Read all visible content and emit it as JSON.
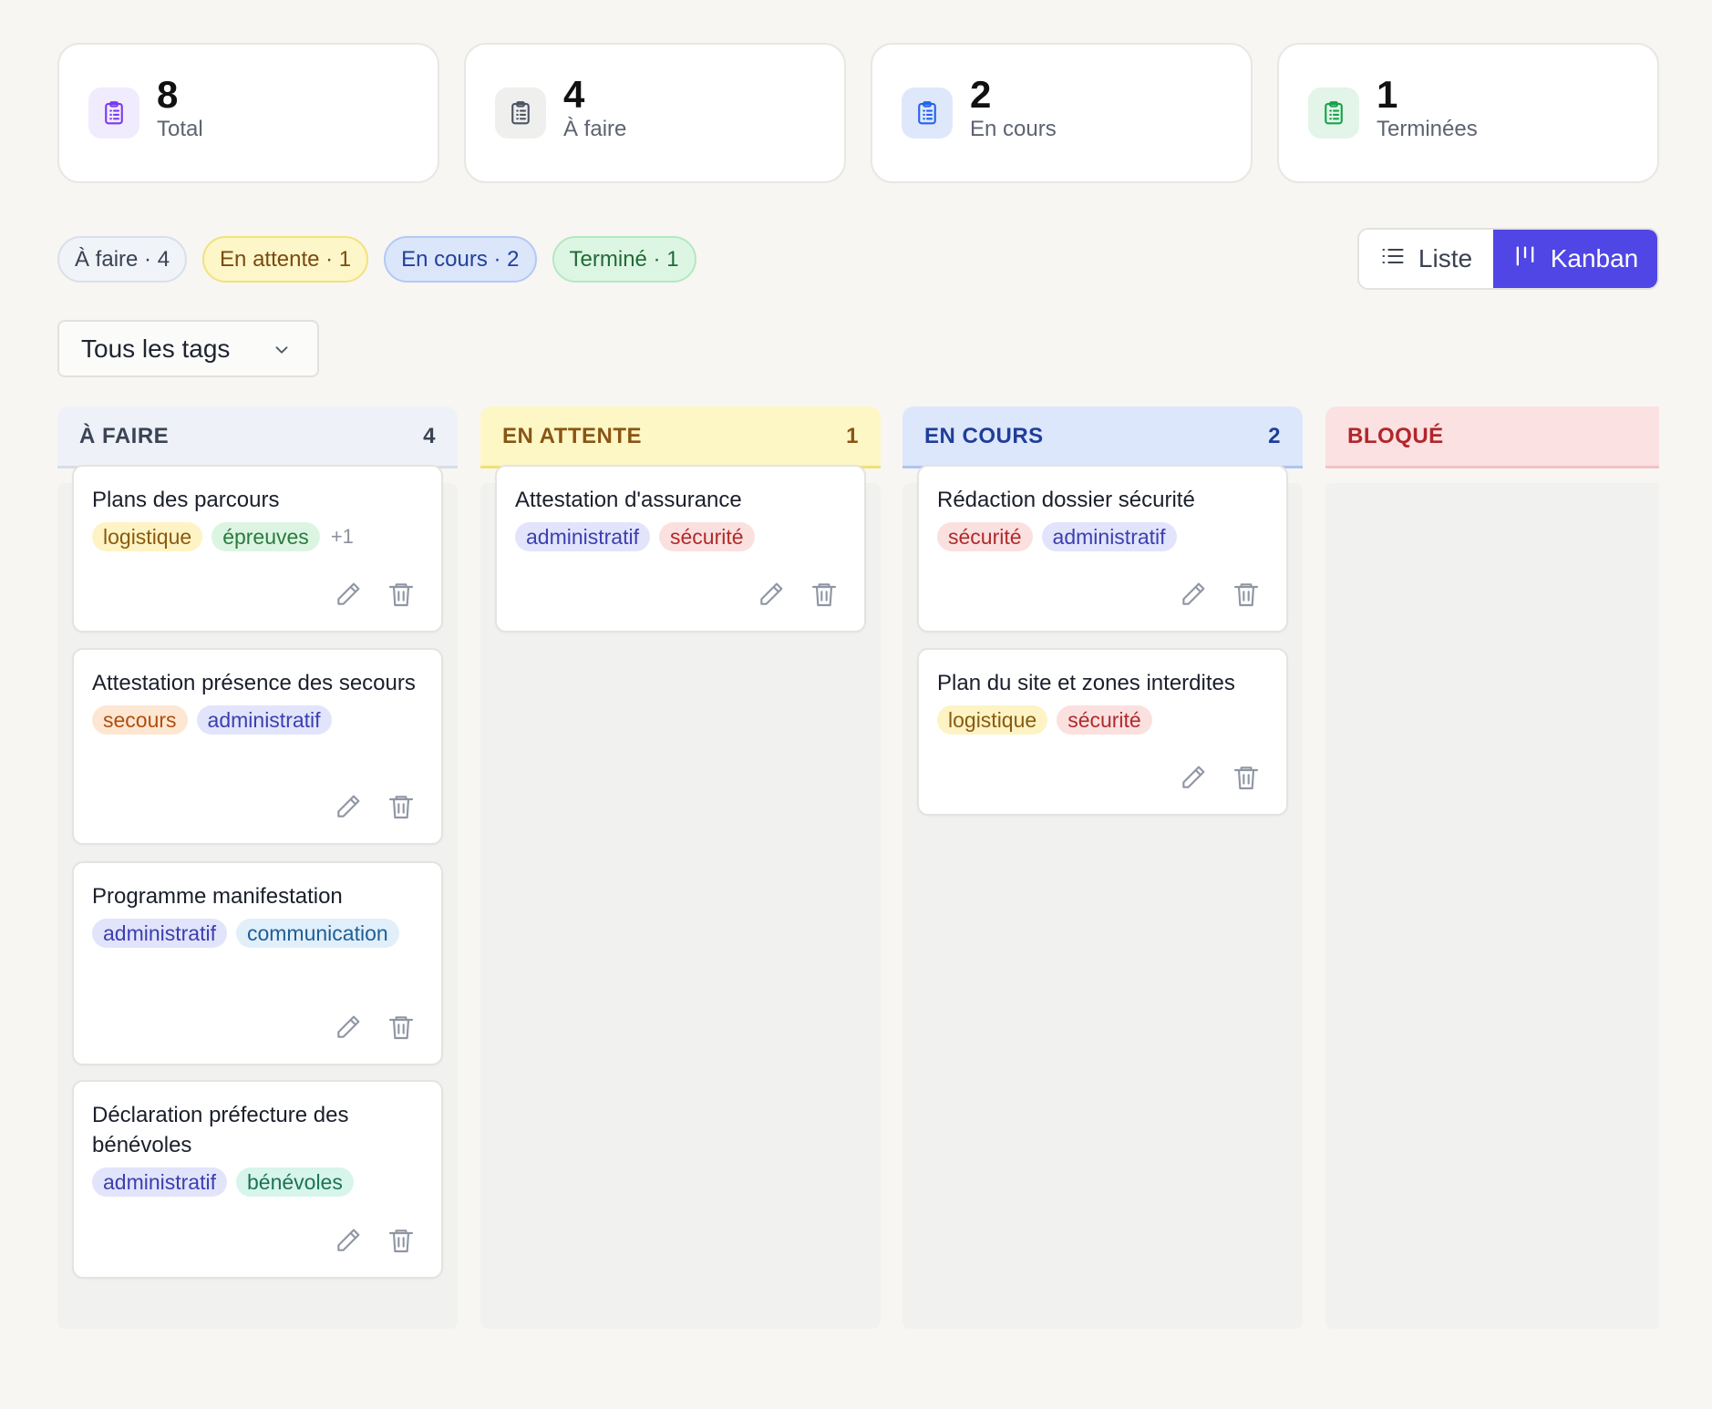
{
  "stats": [
    {
      "value": "8",
      "label": "Total",
      "icon": "clipboard-list-icon",
      "bg": "#f1ecfd",
      "color": "#7c3aed"
    },
    {
      "value": "4",
      "label": "À faire",
      "icon": "clipboard-list-icon",
      "bg": "#efefee",
      "color": "#4b5563"
    },
    {
      "value": "2",
      "label": "En cours",
      "icon": "clipboard-list-icon",
      "bg": "#dfe8fb",
      "color": "#2563eb"
    },
    {
      "value": "1",
      "label": "Terminées",
      "icon": "clipboard-list-icon",
      "bg": "#e3f4e8",
      "color": "#16a34a"
    }
  ],
  "status_chips": [
    {
      "label": "À faire · 4",
      "variant": "todo"
    },
    {
      "label": "En attente · 1",
      "variant": "wait"
    },
    {
      "label": "En cours · 2",
      "variant": "doing"
    },
    {
      "label": "Terminé · 1",
      "variant": "done"
    }
  ],
  "view_toggle": {
    "list_label": "Liste",
    "kanban_label": "Kanban",
    "active": "kanban"
  },
  "tag_filter": {
    "value": "Tous les tags"
  },
  "tag_colors": {
    "logistique": {
      "bg": "#fdf3c4",
      "fg": "#8a5a10"
    },
    "épreuves": {
      "bg": "#dcf5e2",
      "fg": "#2a7a3f"
    },
    "secours": {
      "bg": "#fde7d2",
      "fg": "#b04e0f"
    },
    "administratif": {
      "bg": "#e2e4fb",
      "fg": "#3b3fb0"
    },
    "communication": {
      "bg": "#e1effb",
      "fg": "#1f5e95"
    },
    "bénévoles": {
      "bg": "#d7f5ea",
      "fg": "#1c7356"
    },
    "sécurité": {
      "bg": "#fbe0e0",
      "fg": "#b12a2a"
    }
  },
  "columns": [
    {
      "key": "todo",
      "title": "À FAIRE",
      "count": "4",
      "cards": [
        {
          "title": "Plans des parcours",
          "tags": [
            "logistique",
            "épreuves"
          ],
          "more": "+1"
        },
        {
          "title": "Attestation présence des secours",
          "tags": [
            "secours",
            "administratif"
          ],
          "more": ""
        },
        {
          "title": "Programme manifestation",
          "tags": [
            "administratif",
            "communication"
          ],
          "more": ""
        },
        {
          "title": "Déclaration préfecture des bénévoles",
          "tags": [
            "administratif",
            "bénévoles"
          ],
          "more": ""
        }
      ]
    },
    {
      "key": "wait",
      "title": "EN ATTENTE",
      "count": "1",
      "cards": [
        {
          "title": "Attestation d'assurance",
          "tags": [
            "administratif",
            "sécurité"
          ],
          "more": ""
        }
      ]
    },
    {
      "key": "doing",
      "title": "EN COURS",
      "count": "2",
      "cards": [
        {
          "title": "Rédaction dossier sécurité",
          "tags": [
            "sécurité",
            "administratif"
          ],
          "more": ""
        },
        {
          "title": "Plan du site et zones interdites",
          "tags": [
            "logistique",
            "sécurité"
          ],
          "more": ""
        }
      ]
    },
    {
      "key": "blocked",
      "title": "BLOQUÉ",
      "count": "",
      "cards": []
    }
  ]
}
